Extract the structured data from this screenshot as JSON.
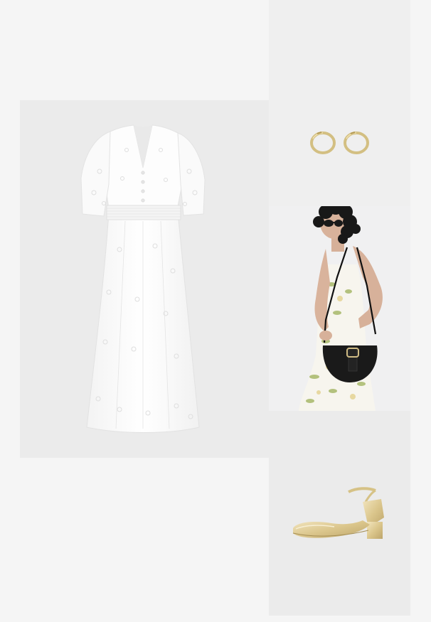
{
  "board": {
    "type": "outfit-collage",
    "items": [
      {
        "id": "dress",
        "icon": "white-eyelet-midi-dress-image"
      },
      {
        "id": "earrings",
        "icon": "gold-hoop-earrings-image"
      },
      {
        "id": "bag",
        "icon": "black-saddle-crossbody-bag-on-model-image"
      },
      {
        "id": "shoes",
        "icon": "gold-block-heel-pump-image"
      }
    ]
  },
  "colors": {
    "page_background": "#f5f5f5",
    "panel_background": "#ebebeb",
    "dress": "#ffffff",
    "gold": "#d8c48a",
    "bag": "#1a1a1a"
  }
}
